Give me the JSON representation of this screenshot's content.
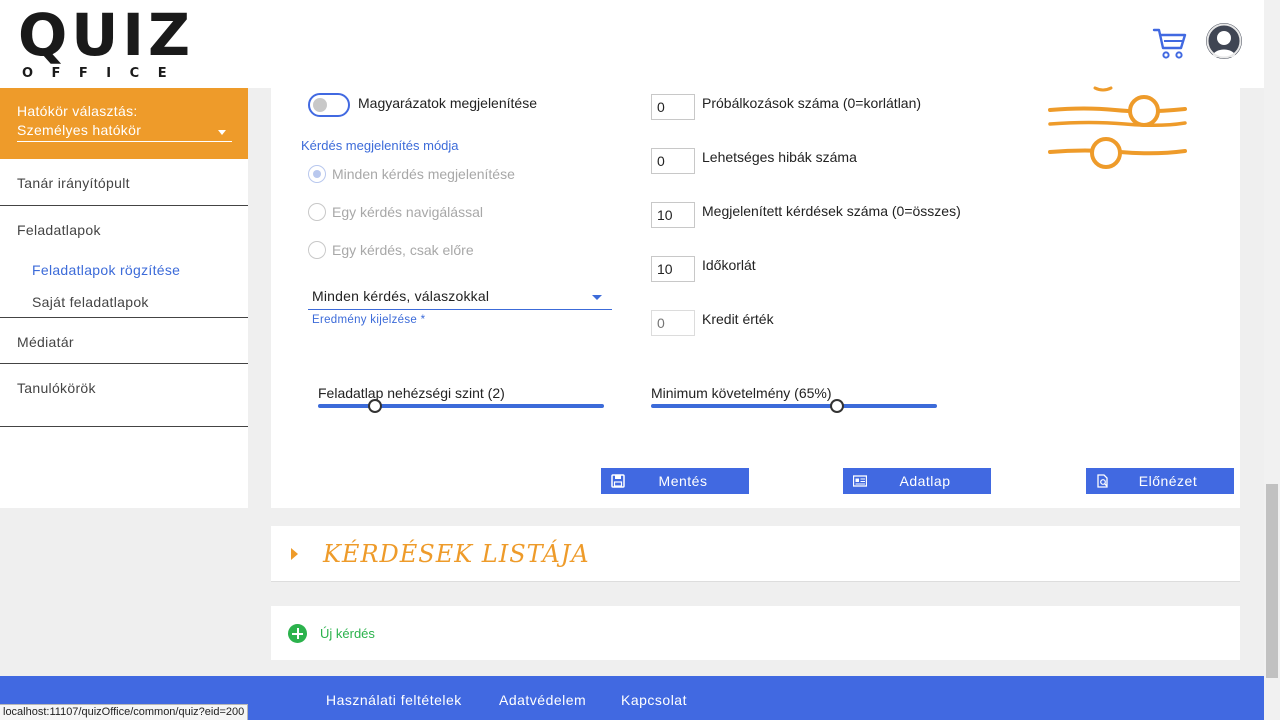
{
  "header": {
    "logo_top": "QUIZ",
    "logo_bottom": "OFFICE",
    "cart_icon": "cart-icon",
    "avatar_icon": "user-avatar-icon"
  },
  "sidebar": {
    "scope_label": "Hatókör választás:",
    "scope_value": "Személyes hatókör",
    "items": [
      {
        "label": "Tanár irányítópult"
      },
      {
        "label": "Feladatlapok"
      },
      {
        "label": "Médiatár"
      },
      {
        "label": "Tanulókörök"
      }
    ],
    "sub_items": [
      {
        "label": "Feladatlapok rögzítése",
        "active": true
      },
      {
        "label": "Saját feladatlapok",
        "active": false
      }
    ]
  },
  "settings": {
    "explanations_toggle_label": "Magyarázatok megjelenítése",
    "explanations_toggle_on": false,
    "display_mode_title": "Kérdés megjelenítés módja",
    "display_modes": [
      {
        "label": "Minden kérdés megjelenítése",
        "checked": true
      },
      {
        "label": "Egy kérdés navigálással",
        "checked": false
      },
      {
        "label": "Egy kérdés, csak előre",
        "checked": false
      }
    ],
    "result_select_value": "Minden kérdés, válaszokkal",
    "result_select_help": "Eredmény kijelzése *",
    "fields": [
      {
        "value": "0",
        "label": "Próbálkozások száma (0=korlátlan)",
        "disabled": false
      },
      {
        "value": "0",
        "label": "Lehetséges hibák száma",
        "disabled": false
      },
      {
        "value": "10",
        "label": "Megjelenített kérdések száma (0=összes)",
        "disabled": false
      },
      {
        "value": "10",
        "label": "Időkorlát",
        "disabled": false
      },
      {
        "value": "",
        "placeholder": "0",
        "label": "Kredit érték",
        "disabled": true
      }
    ],
    "difficulty_label": "Feladatlap nehézségi szint (2)",
    "difficulty_value": 2,
    "difficulty_max": 10,
    "minimum_label": "Minimum követelmény (65%)",
    "minimum_value": 65,
    "minimum_max": 100
  },
  "actions": {
    "save_label": "Mentés",
    "datasheet_label": "Adatlap",
    "preview_label": "Előnézet"
  },
  "questions": {
    "list_title": "KÉRDÉSEK LISTÁJA",
    "new_question_label": "Új kérdés"
  },
  "footer": {
    "terms": "Használati feltételek",
    "privacy": "Adatvédelem",
    "contact": "Kapcsolat"
  },
  "status_bar": {
    "url": "localhost:11107/quizOffice/common/quiz?eid=200"
  },
  "colors": {
    "accent_orange": "#ee9b2a",
    "primary_blue": "#4169e1",
    "success_green": "#2bb24c"
  }
}
